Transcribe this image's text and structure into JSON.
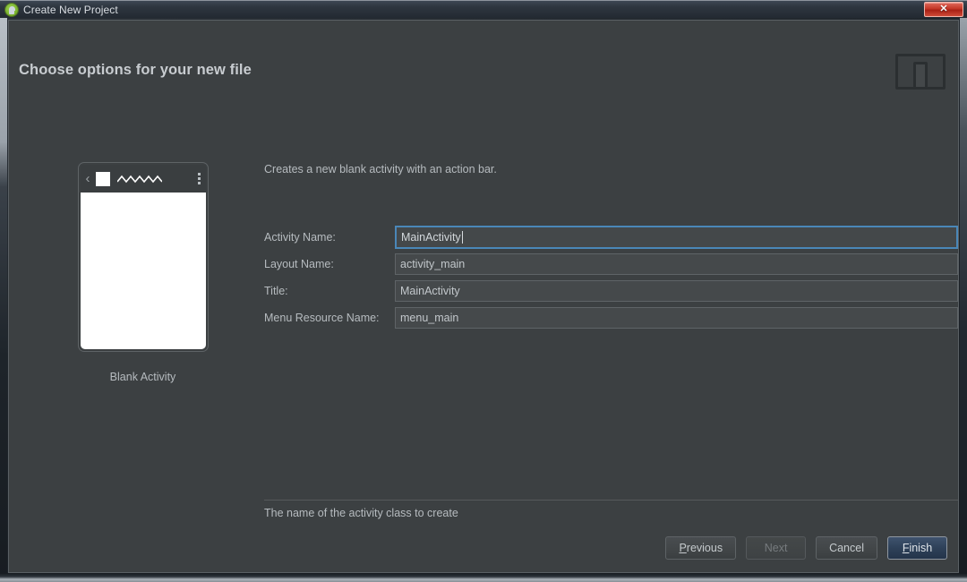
{
  "window": {
    "title": "Create New Project",
    "app_icon": "android-robot-icon",
    "close_label": "✕"
  },
  "header": {
    "page_title": "Choose options for your new file",
    "device_icon": "tablet-and-phone-icon"
  },
  "preview": {
    "caption": "Blank Activity",
    "actionbar": {
      "back_glyph": "‹",
      "logo": "app-logo-square",
      "title_placeholder": "zigzag-title-placeholder",
      "overflow": "overflow-menu-dots"
    }
  },
  "form": {
    "description": "Creates a new blank activity with an action bar.",
    "fields": [
      {
        "label": "Activity Name:",
        "value": "MainActivity",
        "focused": true
      },
      {
        "label": "Layout Name:",
        "value": "activity_main",
        "focused": false
      },
      {
        "label": "Title:",
        "value": "MainActivity",
        "focused": false
      },
      {
        "label": "Menu Resource Name:",
        "value": "menu_main",
        "focused": false
      }
    ],
    "helper_text": "The name of the activity class to create"
  },
  "buttons": {
    "previous": {
      "prefix": "",
      "mnemonic": "P",
      "suffix": "revious"
    },
    "next": {
      "label": "Next"
    },
    "cancel": {
      "label": "Cancel"
    },
    "finish": {
      "prefix": "",
      "mnemonic": "F",
      "suffix": "inish"
    }
  },
  "colors": {
    "dialog_bg": "#3c4042",
    "focus_border": "#4a87b8",
    "primary_button": "#2e4159",
    "close_button": "#c43626",
    "text": "#b6bbbf"
  }
}
